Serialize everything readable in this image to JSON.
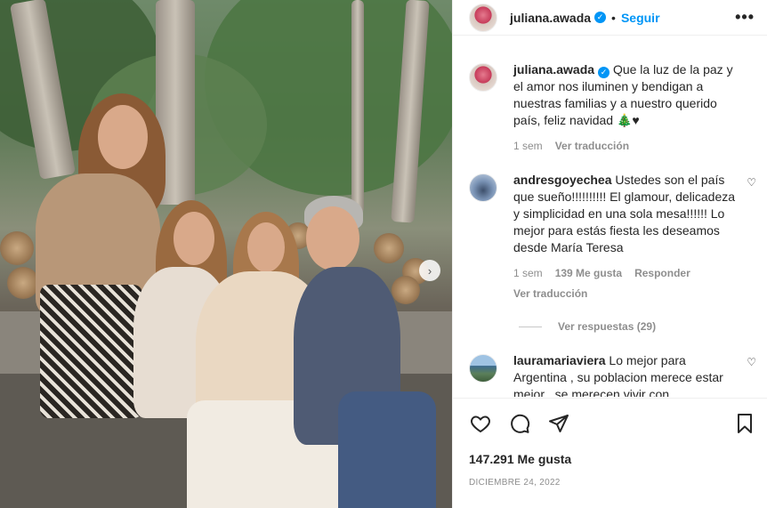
{
  "post": {
    "username": "juliana.awada",
    "follow_label": "Seguir",
    "more_label": "•••",
    "likes": "147.291 Me gusta",
    "date": "DICIEMBRE 24, 2022",
    "next_arrow": "›"
  },
  "caption": {
    "username": "juliana.awada",
    "text": "Que la luz de la paz y el amor nos iluminen y bendigan a nuestras familias y a nuestro querido país, feliz navidad 🎄♥",
    "time": "1 sem",
    "translate": "Ver traducción"
  },
  "comments": [
    {
      "username": "andresgoyechea",
      "text": "Ustedes son el país que sueño!!!!!!!!!! El glamour, delicadeza y simplicidad en una sola mesa!!!!!! Lo mejor para estás fiesta les deseamos desde María Teresa",
      "time": "1 sem",
      "likes": "139 Me gusta",
      "reply": "Responder",
      "translate": "Ver traducción",
      "view_replies": "Ver respuestas (29)"
    },
    {
      "username": "lauramariaviera",
      "text": "Lo mejor para Argentina , su poblacion merece estar mejor , se merecen vivir con"
    }
  ],
  "icons": {
    "like": "heart-icon",
    "comment": "comment-icon",
    "share": "share-icon",
    "save": "bookmark-icon"
  },
  "colors": {
    "link": "#0095f6",
    "muted": "#8e8e8e",
    "text": "#262626"
  }
}
